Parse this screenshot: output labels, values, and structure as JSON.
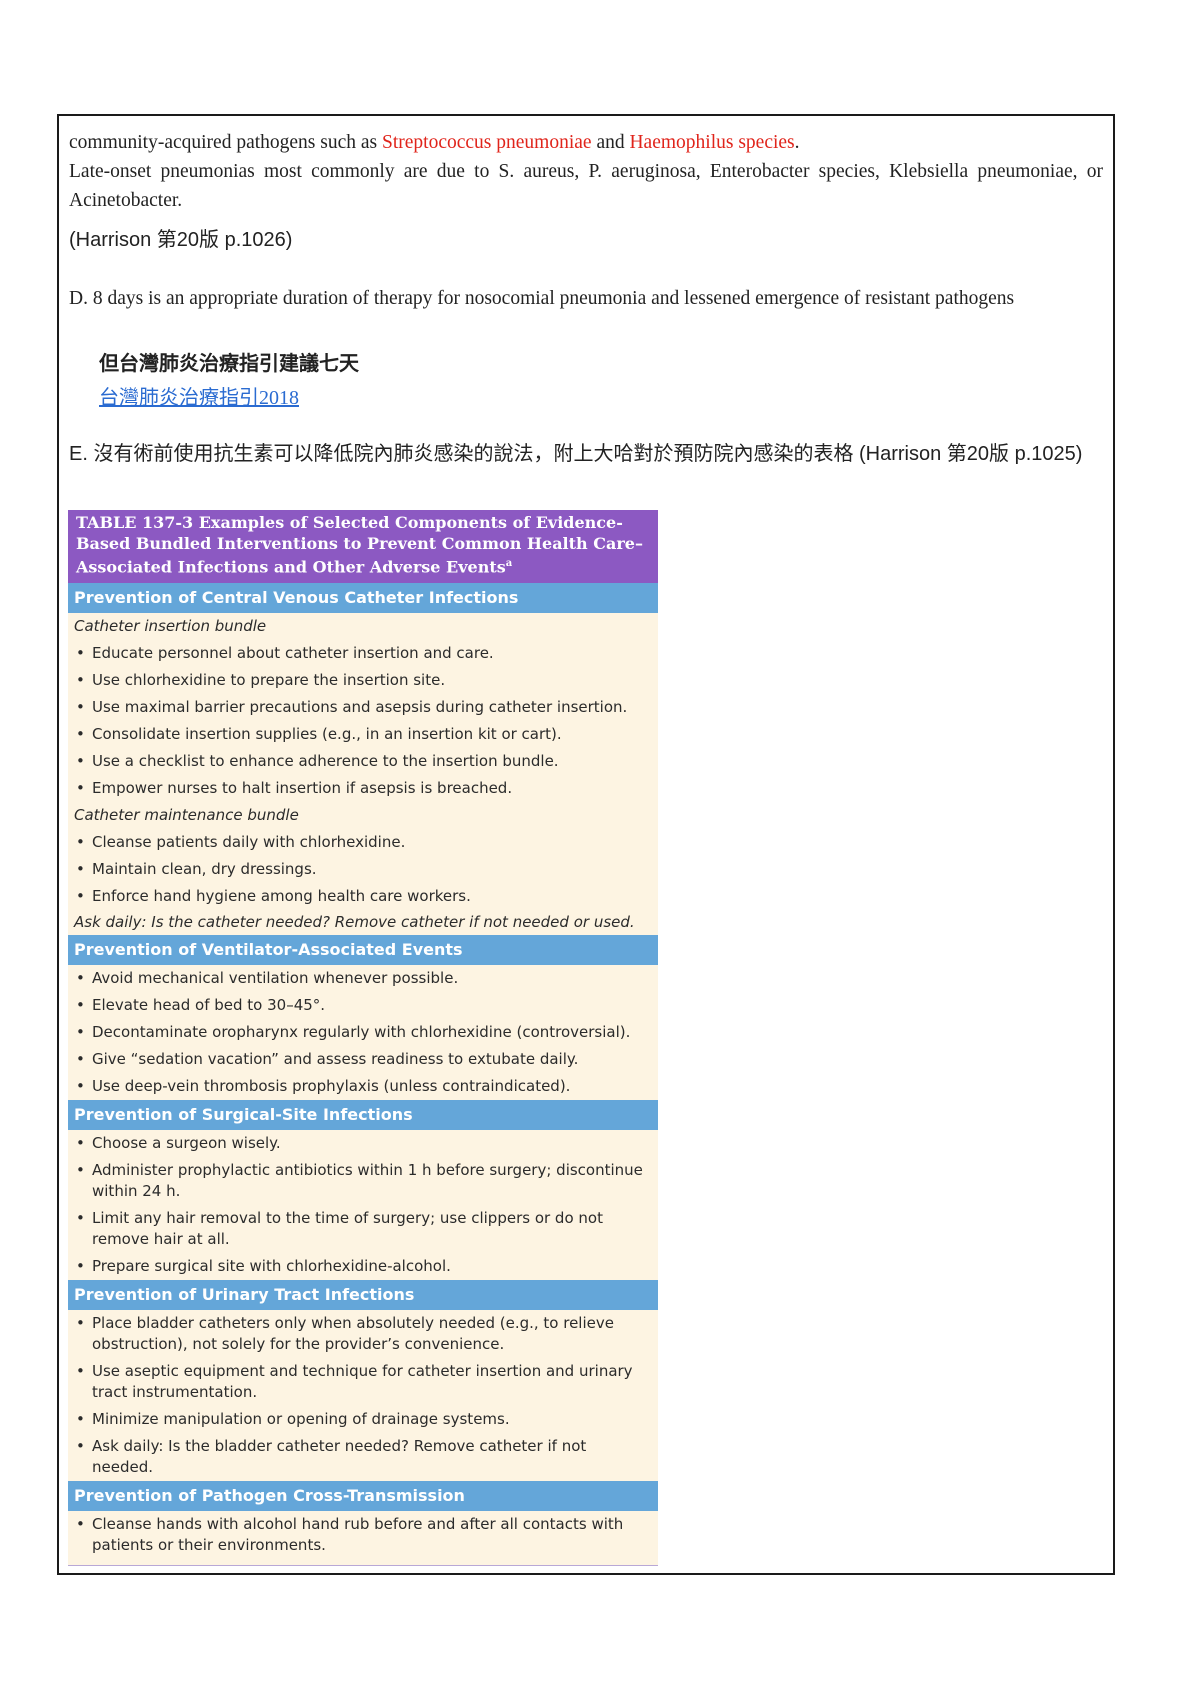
{
  "para_c": {
    "line1_prefix": "community-acquired pathogens such as ",
    "line1_red1": "Streptococcus pneumoniae",
    "line1_mid": " and ",
    "line1_red2": "Haemophilus species",
    "line1_end": ".",
    "line2": "Late-onset pneumonias most commonly are due to S. aureus, P. aeruginosa, Enterobacter species, Klebsiella pneumoniae, or Acinetobacter."
  },
  "citation_c": "(Harrison 第20版 p.1026)",
  "para_d": {
    "text": "D. 8 days is an appropriate duration of therapy for nosocomial pneumonia and lessened emergence of resistant pathogens",
    "note_zh": "但台灣肺炎治療指引建議七天",
    "link_text": "台灣肺炎治療指引2018"
  },
  "para_e": {
    "text": "E. 沒有術前使用抗生素可以降低院內肺炎感染的說法，附上大哈對於預防院內感染的表格 (Harrison 第20版 p.1025)"
  },
  "table": {
    "title": "TABLE 137-3 Examples of Selected Components of Evidence-Based Bundled Interventions to Prevent Common Health Care–Associated Infections and Other Adverse Events",
    "title_sup": "a",
    "bullet": "•",
    "sections": [
      {
        "header": "Prevention of Central Venous Catheter Infections",
        "sub1": "Catheter insertion bundle",
        "items1": [
          "Educate personnel about catheter insertion and care.",
          "Use chlorhexidine to prepare the insertion site.",
          "Use maximal barrier precautions and asepsis during catheter insertion.",
          "Consolidate insertion supplies (e.g., in an insertion kit or cart).",
          "Use a checklist to enhance adherence to the insertion bundle.",
          "Empower nurses to halt insertion if asepsis is breached."
        ],
        "sub2": "Catheter maintenance bundle",
        "items2": [
          "Cleanse patients daily with chlorhexidine.",
          "Maintain clean, dry dressings.",
          "Enforce hand hygiene among health care workers."
        ],
        "ask": "Ask daily: Is the catheter needed? Remove catheter if not needed or used."
      },
      {
        "header": "Prevention of Ventilator-Associated Events",
        "items": [
          "Avoid mechanical ventilation whenever possible.",
          "Elevate head of bed to 30–45°.",
          "Decontaminate oropharynx regularly with chlorhexidine (controversial).",
          "Give “sedation vacation” and assess readiness to extubate daily.",
          "Use deep-vein thrombosis prophylaxis (unless contraindicated)."
        ]
      },
      {
        "header": "Prevention of Surgical-Site Infections",
        "items": [
          "Choose a surgeon wisely.",
          "Administer prophylactic antibiotics within 1 h before surgery; discontinue within 24 h.",
          "Limit any hair removal to the time of surgery; use clippers or do not remove hair at all.",
          "Prepare surgical site with chlorhexidine-alcohol."
        ]
      },
      {
        "header": "Prevention of Urinary Tract Infections",
        "items": [
          "Place bladder catheters only when absolutely needed (e.g., to relieve obstruction), not solely for the provider’s convenience.",
          "Use aseptic equipment and technique for catheter insertion and urinary tract instrumentation.",
          "Minimize manipulation or opening of drainage systems.",
          "Ask daily: Is the bladder catheter needed? Remove catheter if not needed."
        ]
      },
      {
        "header": "Prevention of Pathogen Cross-Transmission",
        "items": [
          "Cleanse hands with alcohol hand rub before and after all contacts with patients or their environments."
        ]
      }
    ]
  }
}
